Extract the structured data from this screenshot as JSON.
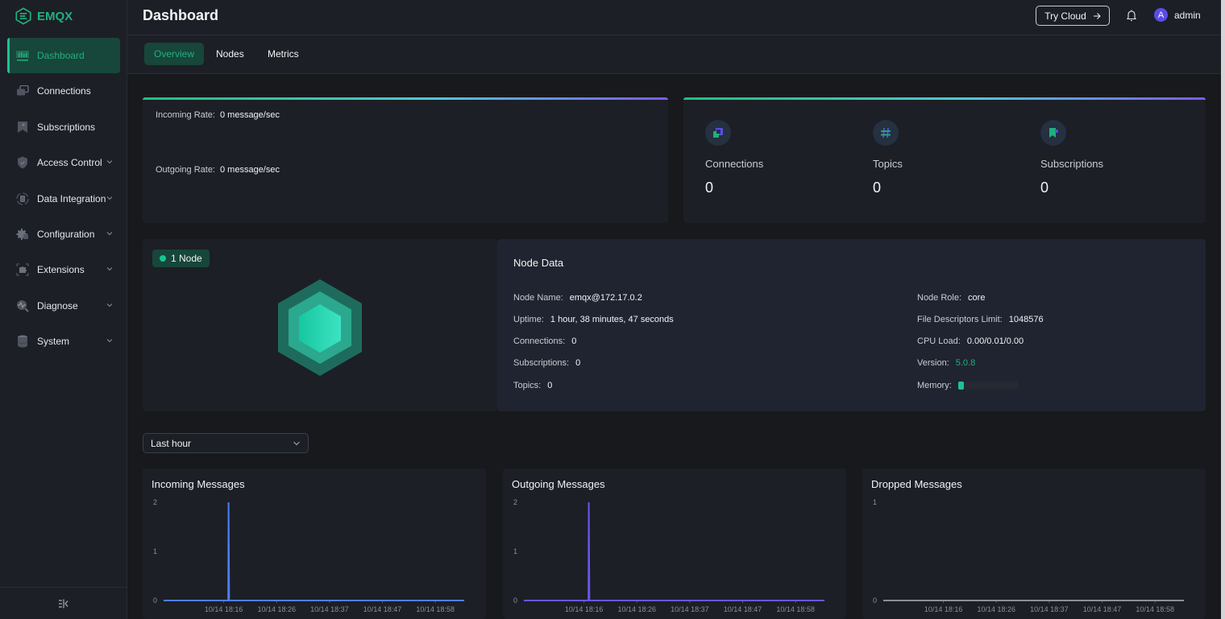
{
  "app": {
    "logo_text": "EMQX",
    "brand_color": "#22b07d"
  },
  "sidebar": {
    "items": [
      {
        "label": "Dashboard",
        "icon": "dashboard-icon",
        "active": true,
        "expandable": false
      },
      {
        "label": "Connections",
        "icon": "connections-icon",
        "active": false,
        "expandable": false
      },
      {
        "label": "Subscriptions",
        "icon": "subscriptions-icon",
        "active": false,
        "expandable": false
      },
      {
        "label": "Access Control",
        "icon": "shield-icon",
        "active": false,
        "expandable": true
      },
      {
        "label": "Data Integration",
        "icon": "data-integration-icon",
        "active": false,
        "expandable": true
      },
      {
        "label": "Configuration",
        "icon": "gear-icon",
        "active": false,
        "expandable": true
      },
      {
        "label": "Extensions",
        "icon": "puzzle-icon",
        "active": false,
        "expandable": true
      },
      {
        "label": "Diagnose",
        "icon": "diagnose-icon",
        "active": false,
        "expandable": true
      },
      {
        "label": "System",
        "icon": "database-icon",
        "active": false,
        "expandable": true
      }
    ],
    "collapse_icon": "collapse-sidebar-icon"
  },
  "header": {
    "title": "Dashboard",
    "try_cloud_label": "Try Cloud",
    "user_initial": "A",
    "user_name": "admin"
  },
  "tabs": [
    {
      "label": "Overview",
      "active": true
    },
    {
      "label": "Nodes",
      "active": false
    },
    {
      "label": "Metrics",
      "active": false
    }
  ],
  "rates": {
    "incoming_label": "Incoming Rate:",
    "incoming_value": "0 message/sec",
    "outgoing_label": "Outgoing Rate:",
    "outgoing_value": "0 message/sec"
  },
  "stats": [
    {
      "label": "Connections",
      "value": "0",
      "icon": "connections-icon"
    },
    {
      "label": "Topics",
      "value": "0",
      "icon": "hash-icon"
    },
    {
      "label": "Subscriptions",
      "value": "0",
      "icon": "subscriptions-icon"
    }
  ],
  "node": {
    "badge": "1 Node",
    "title": "Node Data",
    "left": [
      {
        "label": "Node Name:",
        "value": "emqx@172.17.0.2"
      },
      {
        "label": "Uptime:",
        "value": "1 hour, 38 minutes, 47 seconds"
      },
      {
        "label": "Connections:",
        "value": "0"
      },
      {
        "label": "Subscriptions:",
        "value": "0"
      },
      {
        "label": "Topics:",
        "value": "0"
      }
    ],
    "right": [
      {
        "label": "Node Role:",
        "value": "core"
      },
      {
        "label": "File Descriptors Limit:",
        "value": "1048576"
      },
      {
        "label": "CPU Load:",
        "value": "0.00/0.01/0.00"
      },
      {
        "label": "Version:",
        "value": "5.0.8"
      },
      {
        "label": "Memory:",
        "value": ""
      }
    ],
    "memory_fraction": 0.1
  },
  "time_range": {
    "selected": "Last hour"
  },
  "chart_data": [
    {
      "type": "line",
      "title": "Incoming Messages",
      "color": "#4e7ef3",
      "x": [
        "10/14 18:16",
        "10/14 18:26",
        "10/14 18:37",
        "10/14 18:47",
        "10/14 18:58"
      ],
      "y_ticks": [
        0,
        1,
        2
      ],
      "ylim": [
        0,
        2
      ],
      "series": [
        {
          "name": "Incoming Messages",
          "points": [
            [
              0,
              0
            ],
            [
              0.215,
              0
            ],
            [
              0.216,
              2
            ],
            [
              0.218,
              0
            ],
            [
              1,
              0
            ]
          ]
        }
      ],
      "xlabel": "",
      "ylabel": "",
      "grid": false
    },
    {
      "type": "line",
      "title": "Outgoing Messages",
      "color": "#6a55f2",
      "x": [
        "10/14 18:16",
        "10/14 18:26",
        "10/14 18:37",
        "10/14 18:47",
        "10/14 18:58"
      ],
      "y_ticks": [
        0,
        1,
        2
      ],
      "ylim": [
        0,
        2
      ],
      "series": [
        {
          "name": "Outgoing Messages",
          "points": [
            [
              0,
              0
            ],
            [
              0.215,
              0
            ],
            [
              0.216,
              2
            ],
            [
              0.218,
              0
            ],
            [
              1,
              0
            ]
          ]
        }
      ],
      "xlabel": "",
      "ylabel": "",
      "grid": false
    },
    {
      "type": "line",
      "title": "Dropped Messages",
      "color": "#8a8f98",
      "x": [
        "10/14 18:16",
        "10/14 18:26",
        "10/14 18:37",
        "10/14 18:47",
        "10/14 18:58"
      ],
      "y_ticks": [
        0,
        1
      ],
      "ylim": [
        0,
        1
      ],
      "series": [
        {
          "name": "Dropped Messages",
          "points": [
            [
              0,
              0
            ],
            [
              1,
              0
            ]
          ]
        }
      ],
      "xlabel": "",
      "ylabel": "",
      "grid": false
    }
  ]
}
